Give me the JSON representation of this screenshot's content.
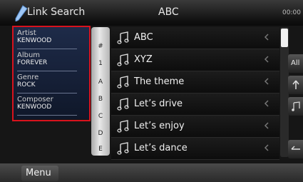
{
  "header": {
    "title": "Link Search",
    "center_title": "ABC",
    "clock": "00:00"
  },
  "info_panel": {
    "items": [
      {
        "label": "Artist",
        "value": "KENWOOD"
      },
      {
        "label": "Album",
        "value": "FOREVER"
      },
      {
        "label": "Genre",
        "value": "ROCK"
      },
      {
        "label": "Composer",
        "value": "KENWOOD"
      }
    ]
  },
  "alpha_index": [
    "#",
    "1",
    "A",
    "B",
    "C",
    "D",
    "E"
  ],
  "list": {
    "items": [
      "ABC",
      "XYZ",
      "The theme",
      "Let’s drive",
      "Let’s enjoy",
      "Let’s dance"
    ]
  },
  "side_buttons": {
    "all_label": "All"
  },
  "footer": {
    "menu_label": "Menu"
  },
  "colors": {
    "highlight": "#d8121d",
    "panel": "#1e2b49"
  },
  "icons": [
    "search-icon",
    "music-note-icon",
    "chevron-left-icon",
    "scroll-up-icon",
    "music-icon",
    "return-icon"
  ]
}
